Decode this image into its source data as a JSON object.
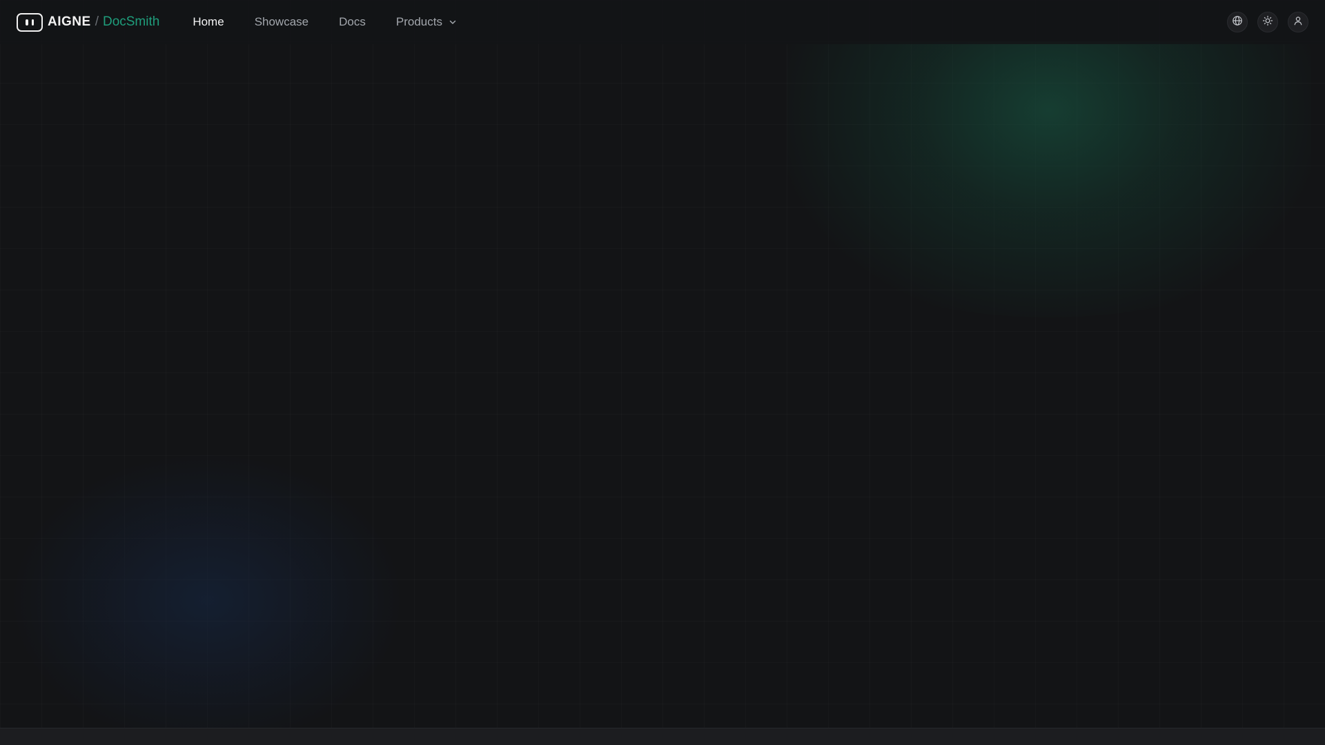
{
  "header": {
    "brand": "AIGNE",
    "separator": "/",
    "product": "DocSmith"
  },
  "nav": {
    "items": [
      {
        "label": "Home",
        "active": true
      },
      {
        "label": "Showcase",
        "active": false
      },
      {
        "label": "Docs",
        "active": false
      },
      {
        "label": "Products",
        "active": false,
        "has_dropdown": true
      }
    ]
  },
  "toolbar": {
    "icons": [
      "globe-icon",
      "sun-icon",
      "user-icon"
    ]
  },
  "colors": {
    "background": "#131416",
    "accent": "#1f9e7c",
    "text_active": "#f4f4f5",
    "text_muted": "#a3a7ad"
  }
}
